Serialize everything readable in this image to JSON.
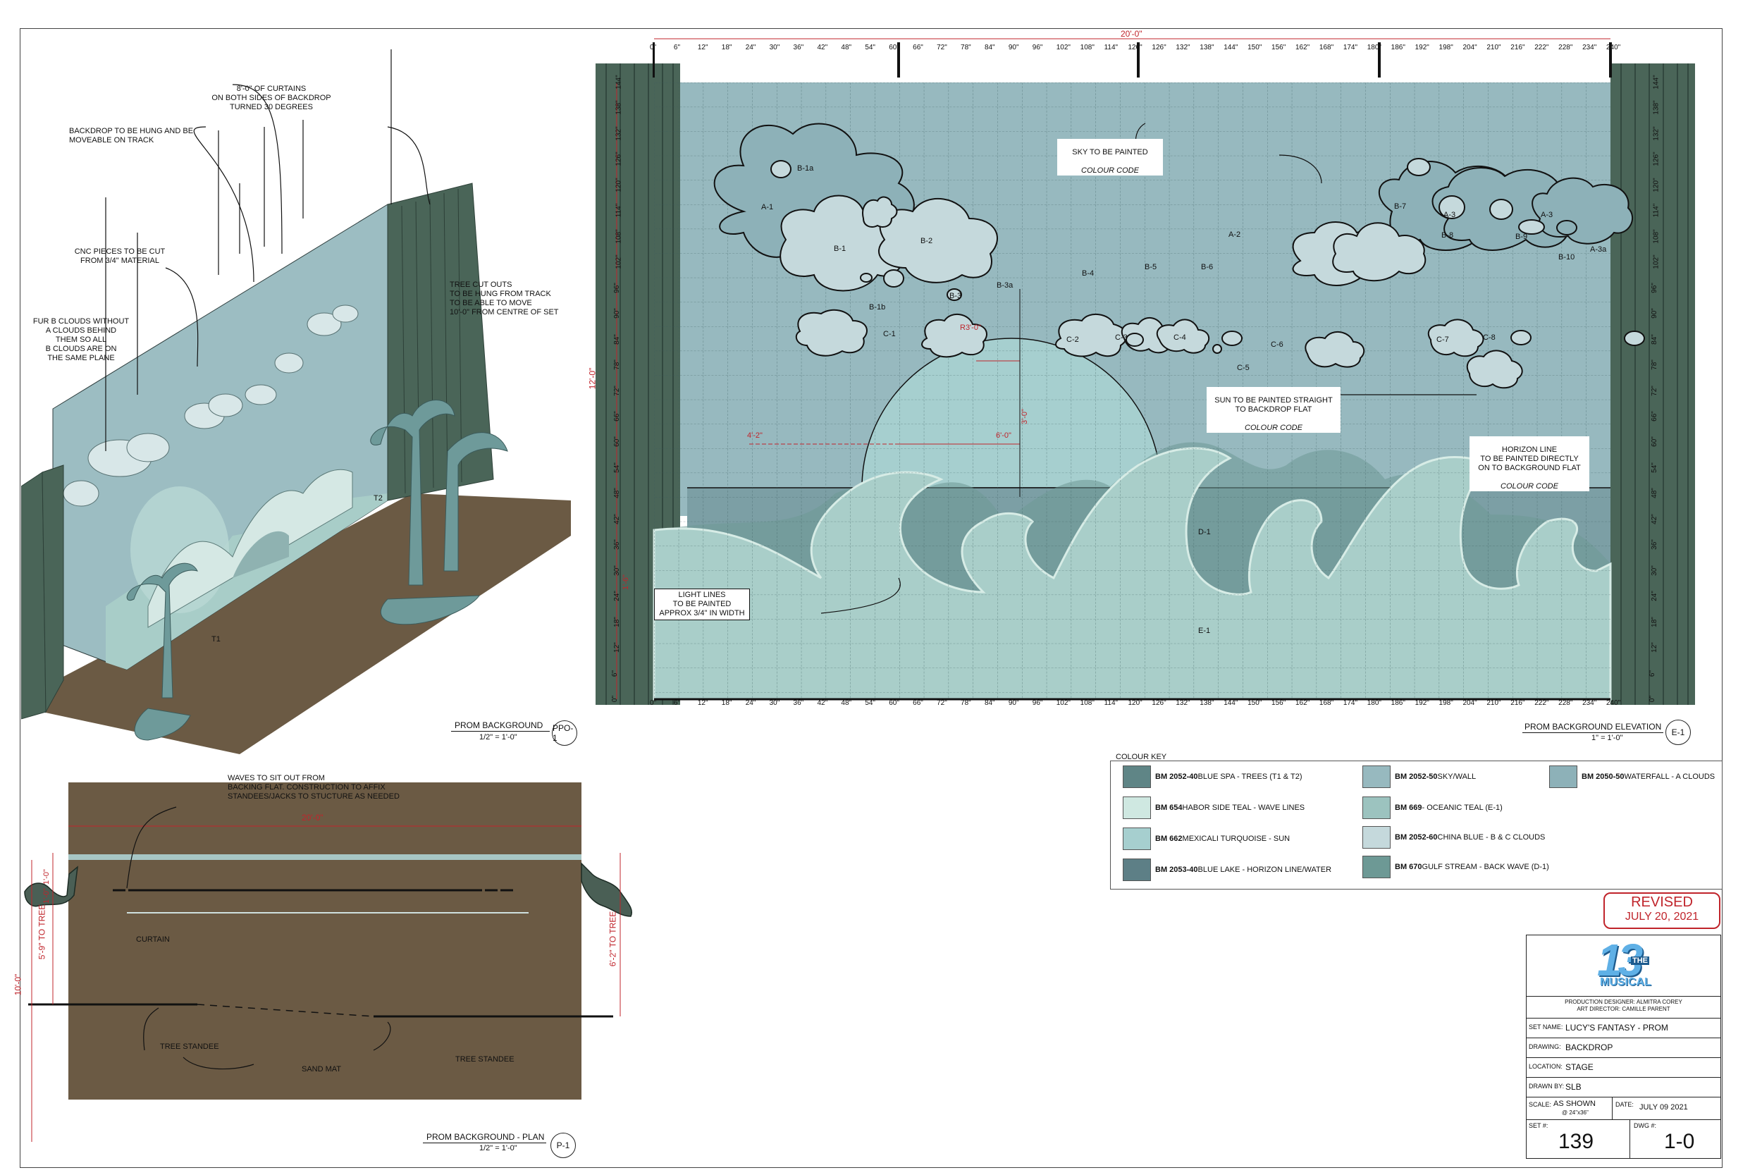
{
  "iso_view": {
    "title": "PROM BACKGROUND",
    "scale": "1/2\" = 1'-0\"",
    "ref": "PPO-1",
    "notes": {
      "curtains": "8'-0\" OF CURTAINS\nON BOTH SIDES OF BACKDROP\nTURNED 30 DEGREES",
      "backdrop": "BACKDROP TO BE HUNG AND BE\nMOVEABLE ON TRACK",
      "cnc": "CNC PIECES TO BE CUT\nFROM 3/4\" MATERIAL",
      "fur": "FUR B CLOUDS WITHOUT\nA CLOUDS BEHIND\nTHEM SO ALL\nB CLOUDS ARE ON\nTHE SAME PLANE",
      "tree": "TREE CUT OUTS\nTO BE HUNG FROM TRACK\nTO BE ABLE TO MOVE\n10'-0\" FROM CENTRE OF SET"
    },
    "markers": [
      "T2",
      "T1"
    ]
  },
  "elevation": {
    "title": "PROM BACKGROUND ELEVATION",
    "scale": "1\" = 1'-0\"",
    "ref": "E-1",
    "width_dim": "20'-0\"",
    "height_dim": "12'-0\"",
    "x_ticks": [
      "0\"",
      "6\"",
      "12\"",
      "18\"",
      "24\"",
      "30\"",
      "36\"",
      "42\"",
      "48\"",
      "54\"",
      "60\"",
      "66\"",
      "72\"",
      "78\"",
      "84\"",
      "90\"",
      "96\"",
      "102\"",
      "108\"",
      "114\"",
      "120\"",
      "126\"",
      "132\"",
      "138\"",
      "144\"",
      "150\"",
      "156\"",
      "162\"",
      "168\"",
      "174\"",
      "180\"",
      "186\"",
      "192\"",
      "198\"",
      "204\"",
      "210\"",
      "216\"",
      "222\"",
      "228\"",
      "234\"",
      "240\""
    ],
    "y_ticks": [
      "0\"",
      "6\"",
      "12\"",
      "18\"",
      "24\"",
      "30\"",
      "36\"",
      "42\"",
      "48\"",
      "54\"",
      "60\"",
      "66\"",
      "72\"",
      "78\"",
      "84\"",
      "90\"",
      "96\"",
      "102\"",
      "108\"",
      "114\"",
      "120\"",
      "126\"",
      "132\"",
      "138\"",
      "144\""
    ],
    "clouds": [
      "A-1",
      "B-1a",
      "B-1",
      "B-2",
      "B-1b",
      "B-3",
      "B-3a",
      "A-2",
      "B-4",
      "B-5",
      "B-6",
      "B-7",
      "A-3",
      "B-8",
      "A-3",
      "B-9",
      "B-10",
      "A-3a",
      "C-1",
      "C-2",
      "C-3",
      "C-4",
      "C-5",
      "C-6",
      "C-7",
      "C-8"
    ],
    "sun_radius": "R3'-0\"",
    "dim_4_2": "4'-2\"",
    "dim_6_0": "6'-0\"",
    "dim_3_0": "3'-0\"",
    "dim_1_6": "1'-6\"",
    "d1": "D-1",
    "e1": "E-1",
    "notes": {
      "sky": "SKY TO BE PAINTED",
      "sky_code": "COLOUR CODE",
      "sun": "SUN TO BE PAINTED STRAIGHT\nTO BACKDROP FLAT",
      "sun_code": "COLOUR CODE",
      "horizon": "HORIZON LINE\nTO BE PAINTED DIRECTLY\nON TO BACKGROUND FLAT",
      "horizon_code": "COLOUR CODE",
      "light": "LIGHT LINES\nTO BE PAINTED\nAPPROX 3/4\" IN WIDTH"
    }
  },
  "plan_view": {
    "title": "PROM BACKGROUND - PLAN",
    "scale": "1/2\" = 1'-0\"",
    "ref": "P-1",
    "note": "WAVES TO SIT OUT FROM\nBACKING FLAT.  CONSTRUCTION TO AFFIX\nSTANDEES/JACKS TO STUCTURE AS NEEDED",
    "width_dim": "20'-0\"",
    "depth_dim": "10'-0\"",
    "left_tree": "5'-9\" TO TREE",
    "right_tree": "6'-2\" TO TREE",
    "small_dim1": "1'-0\"",
    "small_dim2": "1'-0\"",
    "curtain": "CURTAIN",
    "tree_standee_1": "TREE STANDEE",
    "tree_standee_2": "TREE STANDEE",
    "sand_mat": "SAND MAT"
  },
  "colour_key": {
    "title": "COLOUR KEY",
    "items": [
      {
        "code": "BM  2052-40",
        "name": " BLUE SPA - TREES (T1 & T2)",
        "color": "#5f8586"
      },
      {
        "code": "BM 654",
        "name": " HABOR SIDE TEAL - WAVE LINES",
        "color": "#cfe8e1"
      },
      {
        "code": "BM 662",
        "name": " MEXICALI TURQUOISE - SUN",
        "color": "#a6cfcf"
      },
      {
        "code": "BM 2053-40",
        "name": " BLUE LAKE - HORIZON LINE/WATER",
        "color": "#5d7f86"
      },
      {
        "code": "BM 2052-50",
        "name": " SKY/WALL",
        "color": "#97b9bf"
      },
      {
        "code": "BM 669",
        "name": " - OCEANIC TEAL (E-1)",
        "color": "#9cc3bf"
      },
      {
        "code": "BM 2052-60",
        "name": " CHINA BLUE - B & C CLOUDS",
        "color": "#c5d9dc"
      },
      {
        "code": "BM 670",
        "name": " GULF STREAM - BACK WAVE (D-1)",
        "color": "#6d9995"
      },
      {
        "code": "BM 2050-50",
        "name": " WATERFALL - A CLOUDS",
        "color": "#8db1b8"
      }
    ]
  },
  "revised": {
    "label": "REVISED",
    "date": "JULY 20, 2021"
  },
  "title_block": {
    "logo_big": "13",
    "logo_the": "THE",
    "logo_musical": "MUSICAL",
    "designer": "PRODUCTION DESIGNER: ALMITRA COREY",
    "art_director": "ART DIRECTOR:  CAMILLE PARENT",
    "set_name_label": "SET NAME:",
    "set_name": "LUCY'S FANTASY - PROM",
    "drawing_label": "DRAWING:",
    "drawing": "BACKDROP",
    "location_label": "LOCATION:",
    "location": "STAGE",
    "drawn_by_label": "DRAWN BY:",
    "drawn_by": "SLB",
    "scale_label": "SCALE:",
    "scale": "AS SHOWN",
    "scale_sheet": "@ 24\"x36\"",
    "date_label": "DATE:",
    "date": "JULY 09 2021",
    "set_no_label": "SET #:",
    "set_no": "139",
    "dwg_label": "DWG #:",
    "dwg": "1-0"
  },
  "colors": {
    "sky": "#97b9bf",
    "water": "#9cc3bf",
    "curtain": "#4a6558",
    "floor": "#6b5a44",
    "red": "#c0242b"
  }
}
